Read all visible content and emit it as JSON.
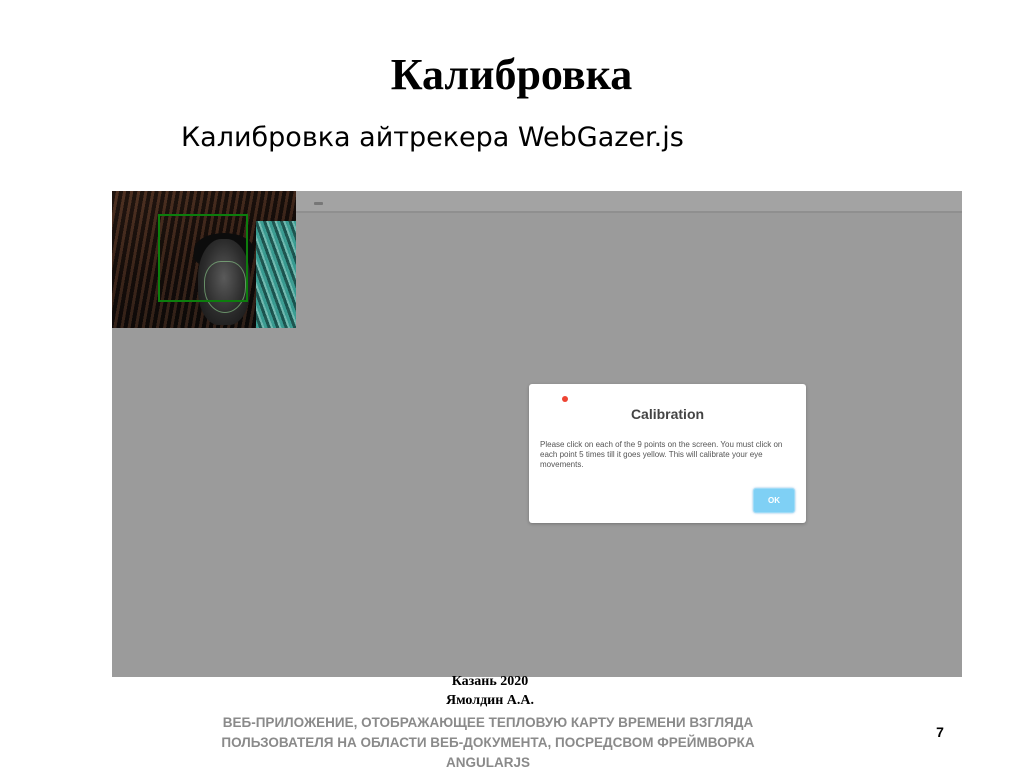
{
  "slide": {
    "title": "Калибровка",
    "subtitle": "Калибровка айтрекера WebGazer.js"
  },
  "screenshot": {
    "dialog": {
      "title": "Calibration",
      "text": "Please click on each of the 9 points on the screen. You must click on each point 5 times till it goes yellow. This will calibrate your eye movements.",
      "ok_label": "OK"
    },
    "colors": {
      "overlay": "#9b9b9b",
      "face_box": "#0d7d0d",
      "calibration_point": "#ee4433",
      "ok_button": "#7fd0f5"
    }
  },
  "footer": {
    "city_year": "Казань 2020",
    "author": "Ямолдин А.А.",
    "project": "ВЕБ-ПРИЛОЖЕНИЕ, ОТОБРАЖАЮЩЕЕ ТЕПЛОВУЮ КАРТУ ВРЕМЕНИ ВЗГЛЯДА ПОЛЬЗОВАТЕЛЯ НА ОБЛАСТИ ВЕБ-ДОКУМЕНТА, ПОСРЕДСВОМ ФРЕЙМВОРКА ANGULARJS",
    "page_number": "7"
  }
}
